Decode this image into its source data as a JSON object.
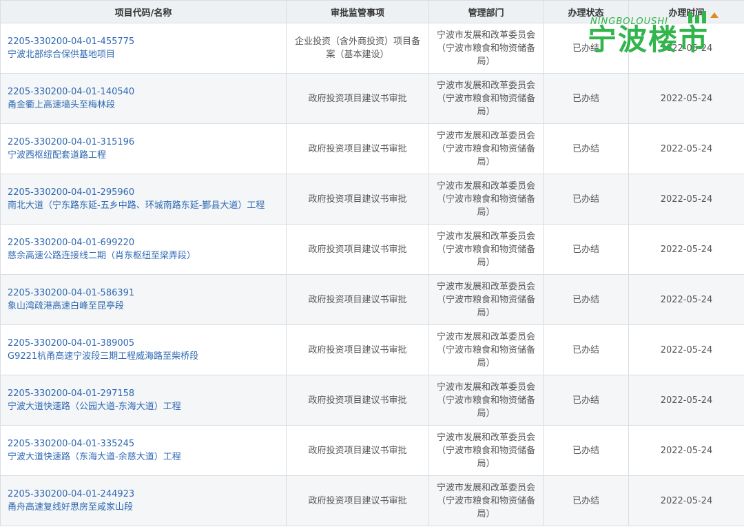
{
  "table": {
    "headers": [
      "项目代码/名称",
      "审批监管事项",
      "管理部门",
      "办理状态",
      "办理时间"
    ],
    "rows": [
      {
        "code": "2205-330200-04-01-455775",
        "name": "宁波北部综合保供基地项目",
        "matter": "企业投资（含外商投资）项目备案（基本建设）",
        "dept": "宁波市发展和改革委员会（宁波市粮食和物资储备局）",
        "status": "已办结",
        "date": "2022-05-24"
      },
      {
        "code": "2205-330200-04-01-140540",
        "name": "甬金衢上高速墙头至梅林段",
        "matter": "政府投资项目建议书审批",
        "dept": "宁波市发展和改革委员会（宁波市粮食和物资储备局）",
        "status": "已办结",
        "date": "2022-05-24"
      },
      {
        "code": "2205-330200-04-01-315196",
        "name": "宁波西枢纽配套道路工程",
        "matter": "政府投资项目建议书审批",
        "dept": "宁波市发展和改革委员会（宁波市粮食和物资储备局）",
        "status": "已办结",
        "date": "2022-05-24"
      },
      {
        "code": "2205-330200-04-01-295960",
        "name": "南北大道（宁东路东延-五乡中路、环城南路东延-鄞县大道）工程",
        "matter": "政府投资项目建议书审批",
        "dept": "宁波市发展和改革委员会（宁波市粮食和物资储备局）",
        "status": "已办结",
        "date": "2022-05-24"
      },
      {
        "code": "2205-330200-04-01-699220",
        "name": "慈余高速公路连接线二期（肖东枢纽至梁弄段）",
        "matter": "政府投资项目建议书审批",
        "dept": "宁波市发展和改革委员会（宁波市粮食和物资储备局）",
        "status": "已办结",
        "date": "2022-05-24"
      },
      {
        "code": "2205-330200-04-01-586391",
        "name": "象山湾疏港高速白峰至昆亭段",
        "matter": "政府投资项目建议书审批",
        "dept": "宁波市发展和改革委员会（宁波市粮食和物资储备局）",
        "status": "已办结",
        "date": "2022-05-24"
      },
      {
        "code": "2205-330200-04-01-389005",
        "name": "G9221杭甬高速宁波段三期工程威海路至柴桥段",
        "matter": "政府投资项目建议书审批",
        "dept": "宁波市发展和改革委员会（宁波市粮食和物资储备局）",
        "status": "已办结",
        "date": "2022-05-24"
      },
      {
        "code": "2205-330200-04-01-297158",
        "name": "宁波大道快速路（公园大道-东海大道）工程",
        "matter": "政府投资项目建议书审批",
        "dept": "宁波市发展和改革委员会（宁波市粮食和物资储备局）",
        "status": "已办结",
        "date": "2022-05-24"
      },
      {
        "code": "2205-330200-04-01-335245",
        "name": "宁波大道快速路（东海大道-余慈大道）工程",
        "matter": "政府投资项目建议书审批",
        "dept": "宁波市发展和改革委员会（宁波市粮食和物资储备局）",
        "status": "已办结",
        "date": "2022-05-24"
      },
      {
        "code": "2205-330200-04-01-244923",
        "name": "甬舟高速复线好思房至咸家山段",
        "matter": "政府投资项目建议书审批",
        "dept": "宁波市发展和改革委员会（宁波市粮食和物资储备局）",
        "status": "已办结",
        "date": "2022-05-24"
      }
    ]
  },
  "watermark": {
    "latin": "NINGBOLOUSHI",
    "chinese": "宁波楼市",
    "color": "#31b54c"
  }
}
